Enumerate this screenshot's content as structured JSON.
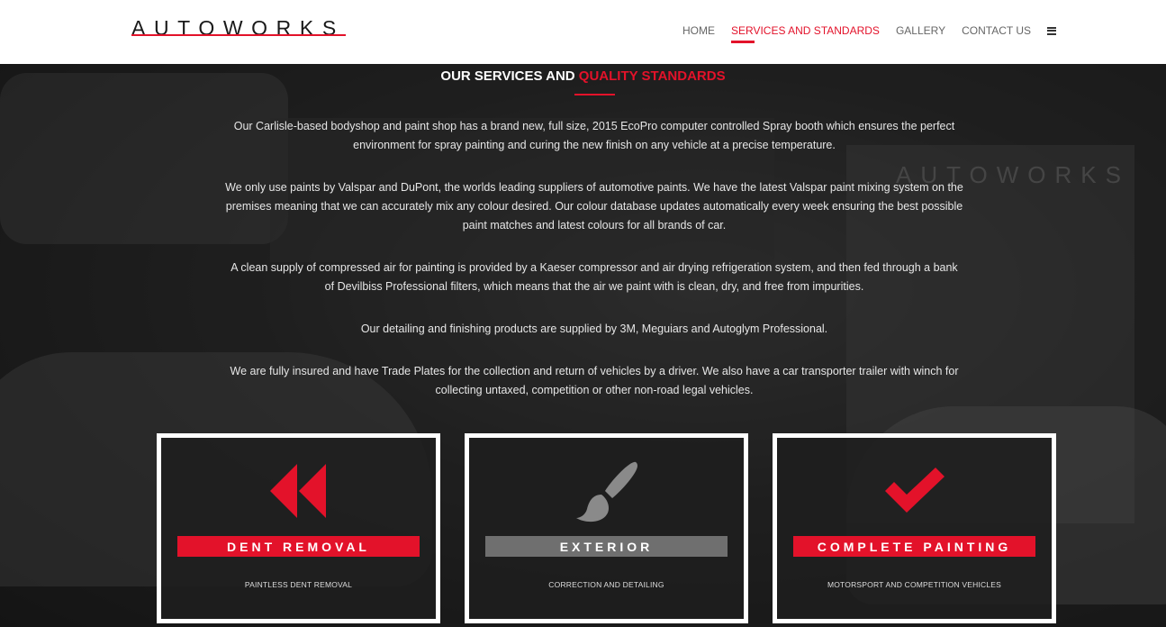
{
  "brand": {
    "name": "AUTOWORKS"
  },
  "nav": {
    "items": [
      {
        "label": "HOME",
        "active": false
      },
      {
        "label": "SERVICES AND STANDARDS",
        "active": true
      },
      {
        "label": "GALLERY",
        "active": false
      },
      {
        "label": "CONTACT US",
        "active": false
      }
    ],
    "menu_icon": "hamburger-icon"
  },
  "section": {
    "heading_plain": "OUR SERVICES AND ",
    "heading_accent": "QUALITY STANDARDS",
    "paragraphs": [
      "Our Carlisle-based bodyshop and paint shop has a brand new, full size, 2015 EcoPro computer controlled Spray booth which ensures the perfect environment for spray painting and curing the new finish on any vehicle at a precise temperature.",
      "We only use paints by Valspar and DuPont, the worlds leading suppliers of automotive paints. We have the latest Valspar paint mixing system on the premises meaning that we can accurately mix any colour desired. Our colour database updates automatically every week ensuring the best possible paint matches and latest colours for all brands of car.",
      "A clean supply of compressed air for painting is provided by a Kaeser compressor and air drying refrigeration system, and then fed through a bank of Devilbiss Professional filters, which means that the air we paint with is clean, dry, and free from impurities.",
      "Our detailing and finishing products are supplied by 3M, Meguiars and Autoglym Professional.",
      "We are fully insured and have Trade Plates for the collection and return of vehicles by a driver. We also have a car transporter trailer with winch for collecting untaxed, competition or other non-road legal vehicles."
    ]
  },
  "cards": [
    {
      "title": "DENT REMOVAL",
      "subtitle": "PAINTLESS DENT REMOVAL",
      "icon": "fast-backward-icon",
      "color": "#e3122a"
    },
    {
      "title": "EXTERIOR",
      "subtitle": "CORRECTION AND DETAILING",
      "icon": "paintbrush-icon",
      "color": "#6f6f6f"
    },
    {
      "title": "COMPLETE PAINTING",
      "subtitle": "MOTORSPORT AND COMPETITION VEHICLES",
      "icon": "checkmark-icon",
      "color": "#e3122a"
    }
  ],
  "colors": {
    "accent": "#e3122a",
    "header_bg": "#ffffff",
    "nav_text": "#666666"
  }
}
